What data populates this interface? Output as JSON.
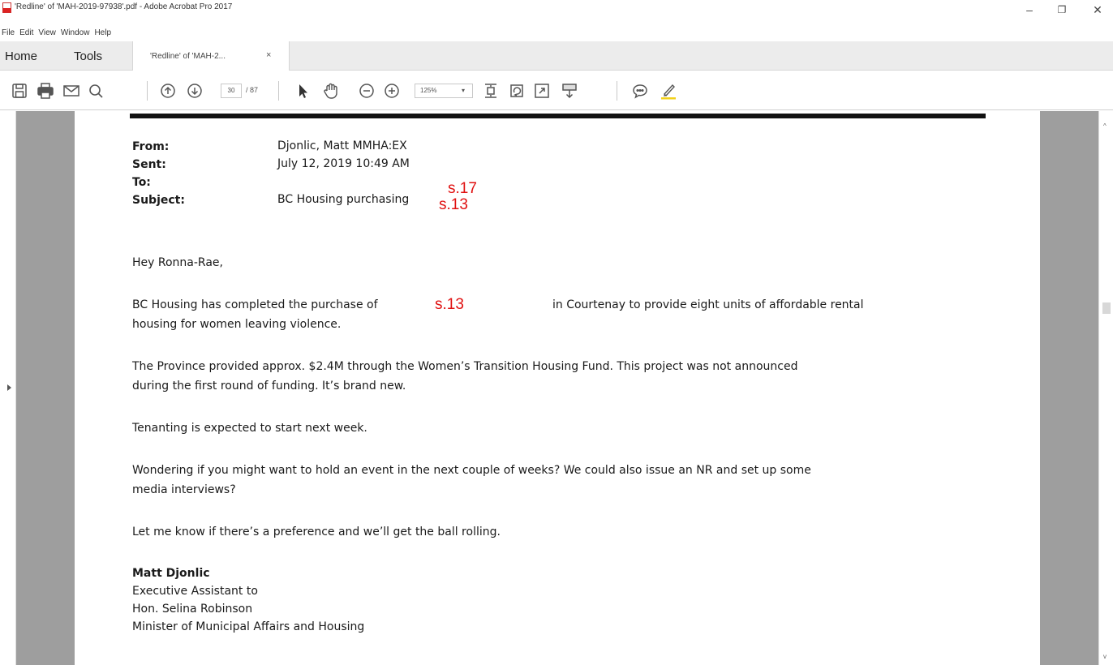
{
  "window": {
    "title": "'Redline' of 'MAH-2019-97938'.pdf - Adobe Acrobat Pro 2017",
    "min_glyph": "–",
    "max_glyph": "❐",
    "close_glyph": "✕"
  },
  "menu": [
    "File",
    "Edit",
    "View",
    "Window",
    "Help"
  ],
  "tabs": {
    "home": "Home",
    "tools": "Tools",
    "document": "'Redline' of 'MAH-2...",
    "close_glyph": "×"
  },
  "toolbar": {
    "icons": [
      "save-icon",
      "print-icon",
      "email-icon",
      "search-icon",
      "previous-page-icon",
      "next-page-icon",
      "select-arrow-icon",
      "hand-tool-icon",
      "zoom-out-icon",
      "zoom-in-icon",
      "fit-page-icon",
      "rotate-icon",
      "full-screen-icon",
      "read-mode-icon",
      "comment-icon",
      "highlight-icon"
    ],
    "page_current": "30",
    "page_total": "/ 87",
    "zoom": "125%",
    "zoom_arrow": "▾"
  },
  "email": {
    "from_label": "From:",
    "from_value": "Djonlic, Matt MMHA:EX",
    "sent_label": "Sent:",
    "sent_value": "July 12, 2019 10:49 AM",
    "to_label": "To:",
    "to_redaction": "s.17",
    "subject_label": "Subject:",
    "subject_value": "BC Housing purchasing",
    "subject_redaction": "s.13",
    "greeting": "Hey Ronna-Rae,",
    "para1_before": "BC Housing has completed the purchase of",
    "para1_redaction": "s.13",
    "para1_after": "in Courtenay to provide eight units of affordable rental",
    "para1_line2": "housing for women leaving violence.",
    "para2_line1": "The Province provided approx. $2.4M through the Women’s Transition Housing Fund. This project was not announced",
    "para2_line2": "during the first round of funding. It’s brand new.",
    "para3": "Tenanting is expected to start next week.",
    "para4_line1": "Wondering if you might want to hold an event in the next couple of weeks? We could also issue an NR and set up some",
    "para4_line2": "media interviews?",
    "para5": "Let me know if there’s a preference and we’ll get the ball rolling.",
    "signature": {
      "name": "Matt Djonlic",
      "line1": "Executive Assistant to",
      "line2": "Hon. Selina Robinson",
      "line3": "Minister of Municipal Affairs and Housing"
    }
  },
  "scrollbar": {
    "up_glyph": "^",
    "down_glyph": "v"
  },
  "colors": {
    "redaction": "#e01010",
    "highlighter": "#f2d11b",
    "page_gutter": "#9e9e9e"
  }
}
